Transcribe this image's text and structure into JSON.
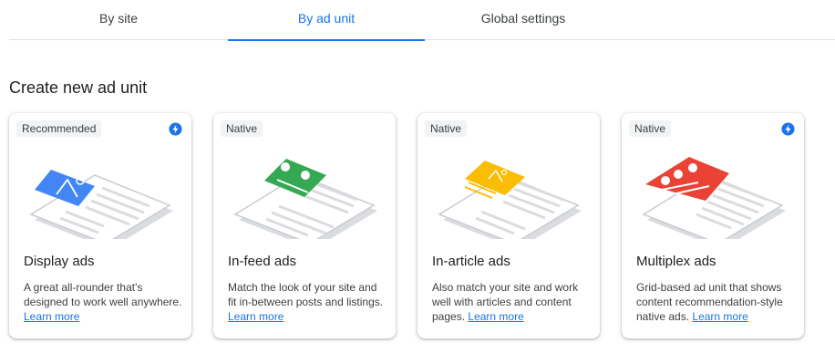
{
  "tabs": [
    {
      "label": "By site"
    },
    {
      "label": "By ad unit"
    },
    {
      "label": "Global settings"
    }
  ],
  "heading": "Create new ad unit",
  "cards": [
    {
      "badge": "Recommended",
      "title": "Display ads",
      "description": "A great all-rounder that's designed to work well anywhere.",
      "link": "Learn more",
      "accent": "#4285f4"
    },
    {
      "badge": "Native",
      "title": "In-feed ads",
      "description": "Match the look of your site and fit in-between posts and listings.",
      "link": "Learn more",
      "accent": "#34a853"
    },
    {
      "badge": "Native",
      "title": "In-article ads",
      "description": "Also match your site and work well with articles and content pages.",
      "link": "Learn more",
      "accent": "#fbbc04"
    },
    {
      "badge": "Native",
      "title": "Multiplex ads",
      "description": "Grid-based ad unit that shows content recommendation-style native ads.",
      "link": "Learn more",
      "accent": "#ea4335"
    }
  ],
  "colors": {
    "brand": "#1a73e8",
    "bolt": "#1a73e8"
  },
  "icons": {
    "auto_ads": "bolt-icon"
  }
}
